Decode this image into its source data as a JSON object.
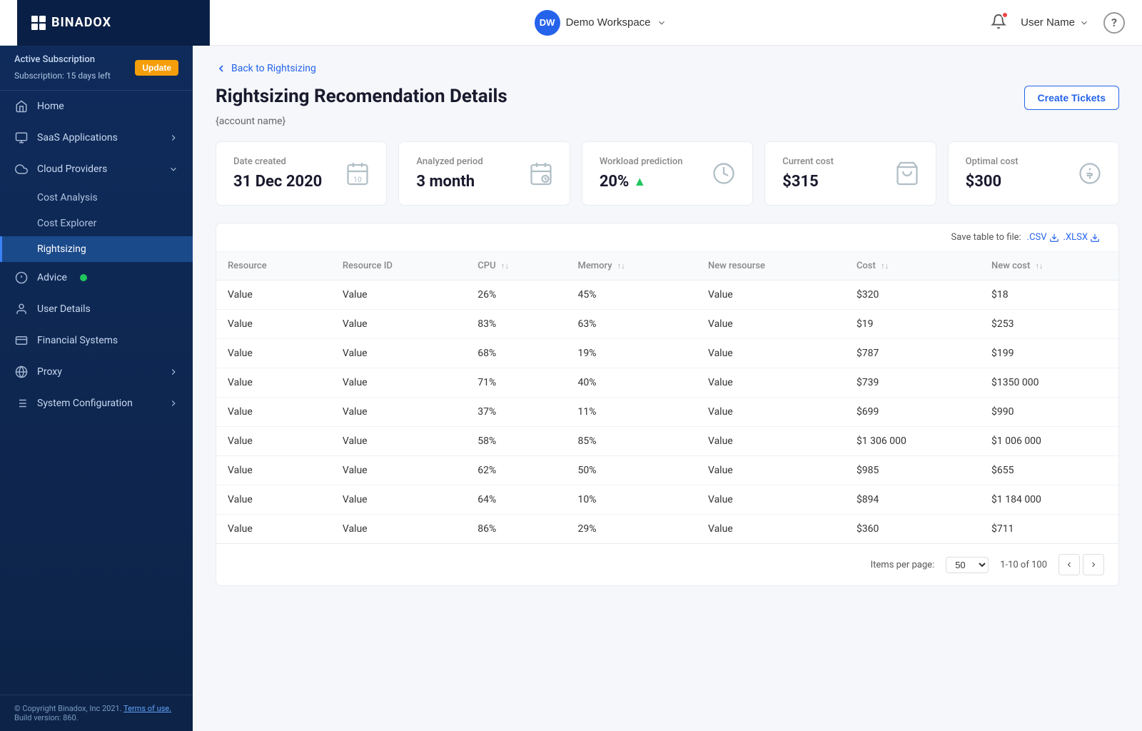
{
  "header": {
    "logo_text": "BINADOX",
    "workspace_initials": "DW",
    "workspace_name": "Demo Workspace",
    "user_name": "User Name",
    "help_label": "?"
  },
  "sidebar": {
    "subscription_label": "Active Subscription",
    "update_label": "Update",
    "subscription_days": "Subscription: 15 days left",
    "nav_items": [
      {
        "id": "home",
        "label": "Home",
        "icon": "home"
      },
      {
        "id": "saas",
        "label": "SaaS Applications",
        "icon": "saas",
        "has_arrow": true
      },
      {
        "id": "cloud",
        "label": "Cloud Providers",
        "icon": "cloud",
        "expanded": true
      },
      {
        "id": "cost-analysis",
        "label": "Cost Analysis",
        "sub": true
      },
      {
        "id": "cost-explorer",
        "label": "Cost Explorer",
        "sub": true
      },
      {
        "id": "rightsizing",
        "label": "Rightsizing",
        "sub": true,
        "active": true
      },
      {
        "id": "advice",
        "label": "Advice",
        "icon": "advice",
        "has_dot": true
      },
      {
        "id": "user-details",
        "label": "User Details",
        "icon": "user"
      },
      {
        "id": "financial",
        "label": "Financial Systems",
        "icon": "financial"
      },
      {
        "id": "proxy",
        "label": "Proxy",
        "icon": "proxy",
        "has_arrow": true
      },
      {
        "id": "system-config",
        "label": "System Configuration",
        "icon": "config",
        "has_arrow": true
      }
    ],
    "footer_copyright": "© Copyright Binadox, Inc 2021.",
    "footer_terms": "Terms of use.",
    "footer_build": "Build version: 860."
  },
  "breadcrumb": {
    "back_label": "Back to Rightsizing"
  },
  "page": {
    "title": "Rightsizing Recomendation Details",
    "account_name": "{account name}",
    "create_tickets_label": "Create Tickets"
  },
  "summary_cards": [
    {
      "id": "date-created",
      "label": "Date created",
      "value": "31 Dec 2020",
      "icon": "calendar"
    },
    {
      "id": "analyzed-period",
      "label": "Analyzed period",
      "value": "3 month",
      "icon": "calendar-clock"
    },
    {
      "id": "workload-prediction",
      "label": "Workload prediction",
      "value": "20%",
      "trend": "up",
      "icon": "clock-dollar"
    },
    {
      "id": "current-cost",
      "label": "Current cost",
      "value": "$315",
      "icon": "bag"
    },
    {
      "id": "optimal-cost",
      "label": "Optimal cost",
      "value": "$300",
      "icon": "coin"
    }
  ],
  "table": {
    "save_label": "Save table to file:",
    "csv_label": ".CSV",
    "xlsx_label": ".XLSX",
    "columns": [
      {
        "id": "resource",
        "label": "Resource",
        "sortable": false
      },
      {
        "id": "resource-id",
        "label": "Resource ID",
        "sortable": false
      },
      {
        "id": "cpu",
        "label": "CPU",
        "sortable": true
      },
      {
        "id": "memory",
        "label": "Memory",
        "sortable": true
      },
      {
        "id": "new-resource",
        "label": "New resourse",
        "sortable": false
      },
      {
        "id": "cost",
        "label": "Cost",
        "sortable": true
      },
      {
        "id": "new-cost",
        "label": "New cost",
        "sortable": true
      }
    ],
    "rows": [
      {
        "resource": "Value",
        "resource_id": "Value",
        "cpu": "26%",
        "memory": "45%",
        "new_resource": "Value",
        "cost": "$320",
        "new_cost": "$18"
      },
      {
        "resource": "Value",
        "resource_id": "Value",
        "cpu": "83%",
        "memory": "63%",
        "new_resource": "Value",
        "cost": "$19",
        "new_cost": "$253"
      },
      {
        "resource": "Value",
        "resource_id": "Value",
        "cpu": "68%",
        "memory": "19%",
        "new_resource": "Value",
        "cost": "$787",
        "new_cost": "$199"
      },
      {
        "resource": "Value",
        "resource_id": "Value",
        "cpu": "71%",
        "memory": "40%",
        "new_resource": "Value",
        "cost": "$739",
        "new_cost": "$1350 000"
      },
      {
        "resource": "Value",
        "resource_id": "Value",
        "cpu": "37%",
        "memory": "11%",
        "new_resource": "Value",
        "cost": "$699",
        "new_cost": "$990"
      },
      {
        "resource": "Value",
        "resource_id": "Value",
        "cpu": "58%",
        "memory": "85%",
        "new_resource": "Value",
        "cost": "$1 306 000",
        "new_cost": "$1 006 000"
      },
      {
        "resource": "Value",
        "resource_id": "Value",
        "cpu": "62%",
        "memory": "50%",
        "new_resource": "Value",
        "cost": "$985",
        "new_cost": "$655"
      },
      {
        "resource": "Value",
        "resource_id": "Value",
        "cpu": "64%",
        "memory": "10%",
        "new_resource": "Value",
        "cost": "$894",
        "new_cost": "$1 184 000"
      },
      {
        "resource": "Value",
        "resource_id": "Value",
        "cpu": "86%",
        "memory": "29%",
        "new_resource": "Value",
        "cost": "$360",
        "new_cost": "$711"
      }
    ]
  },
  "pagination": {
    "items_per_page_label": "Items per page:",
    "items_per_page_value": "50",
    "range_label": "1-10 of 100"
  }
}
